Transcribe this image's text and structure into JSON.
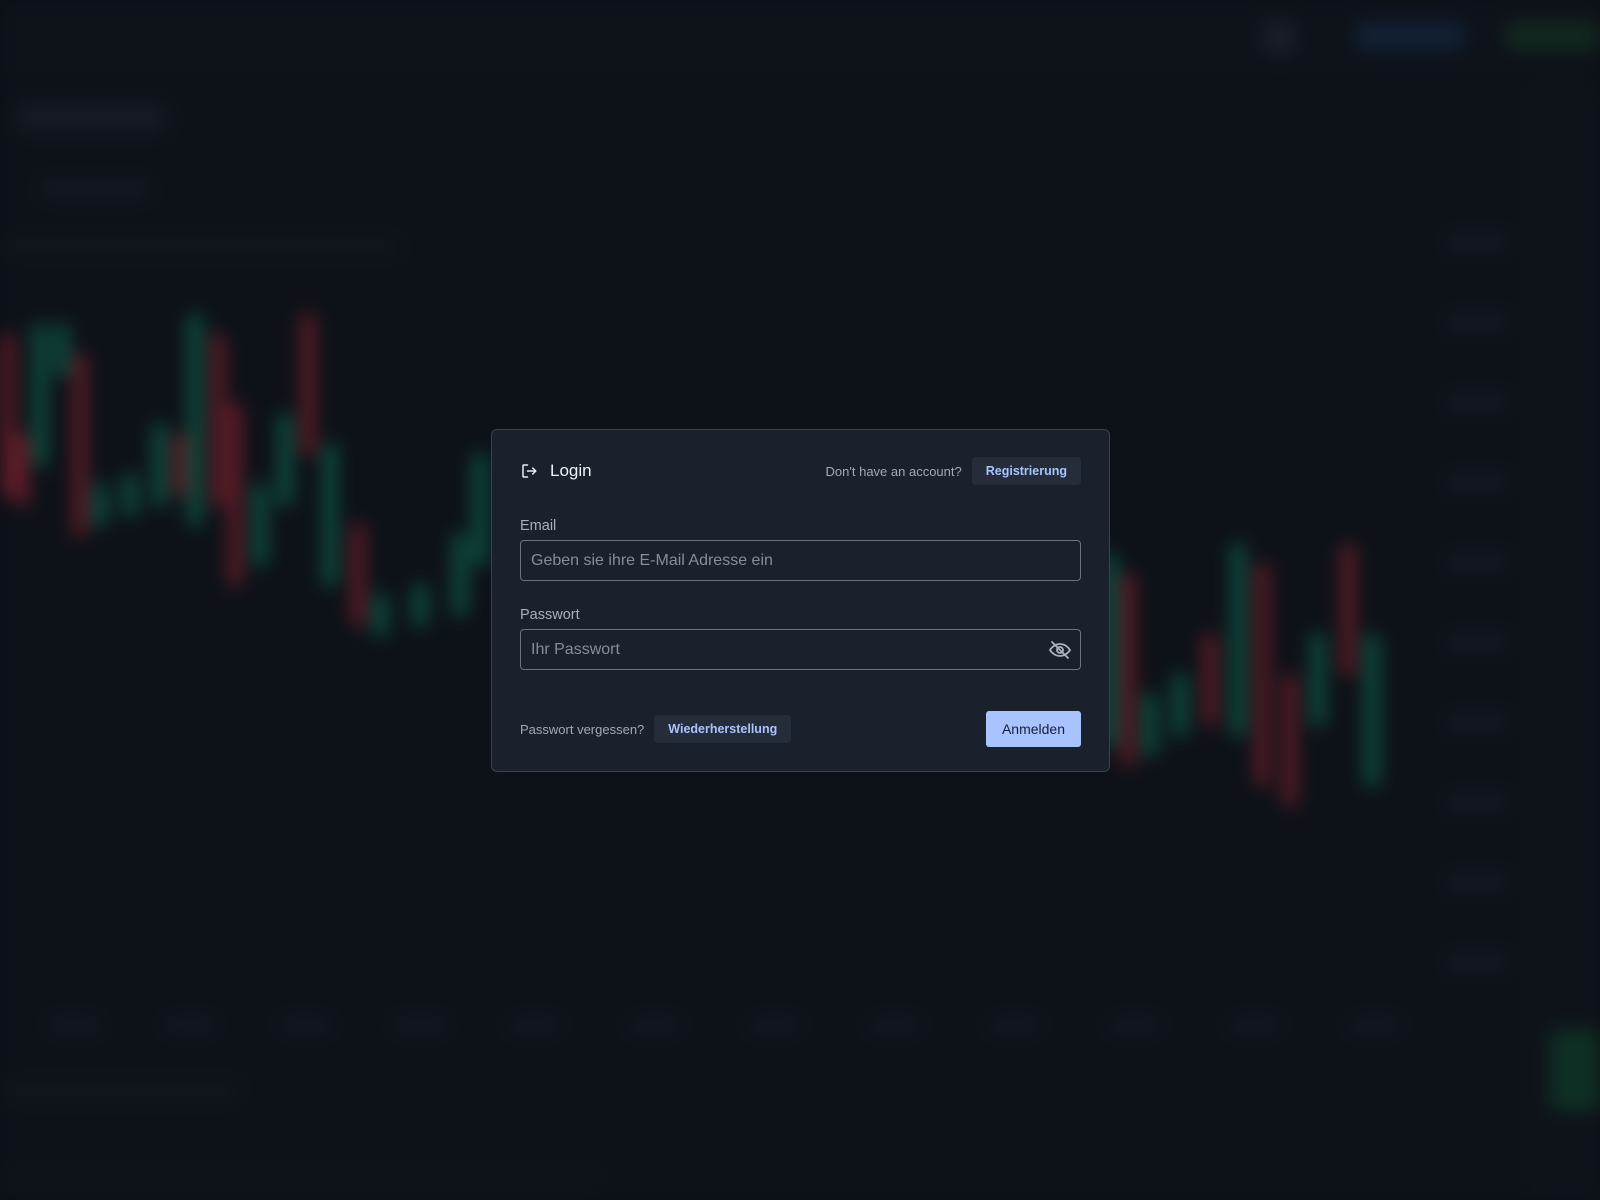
{
  "dialog": {
    "title": "Login",
    "no_account_text": "Don't have an account?",
    "register_label": "Registrierung",
    "email": {
      "label": "Email",
      "placeholder": "Geben sie ihre E-Mail Adresse ein",
      "value": ""
    },
    "password": {
      "label": "Passwort",
      "placeholder": "Ihr Passwort",
      "value": ""
    },
    "forgot_text": "Passwort vergessen?",
    "recovery_label": "Wiederherstellung",
    "submit_label": "Anmelden",
    "icons": {
      "title_icon": "login-icon",
      "password_toggle_icon": "eye-off-icon"
    }
  },
  "colors": {
    "accent": "#a9c3ff",
    "dialog_bg": "#1b212c",
    "page_bg": "#10141c",
    "candle_up": "#12a37a",
    "candle_down": "#c8303f"
  }
}
